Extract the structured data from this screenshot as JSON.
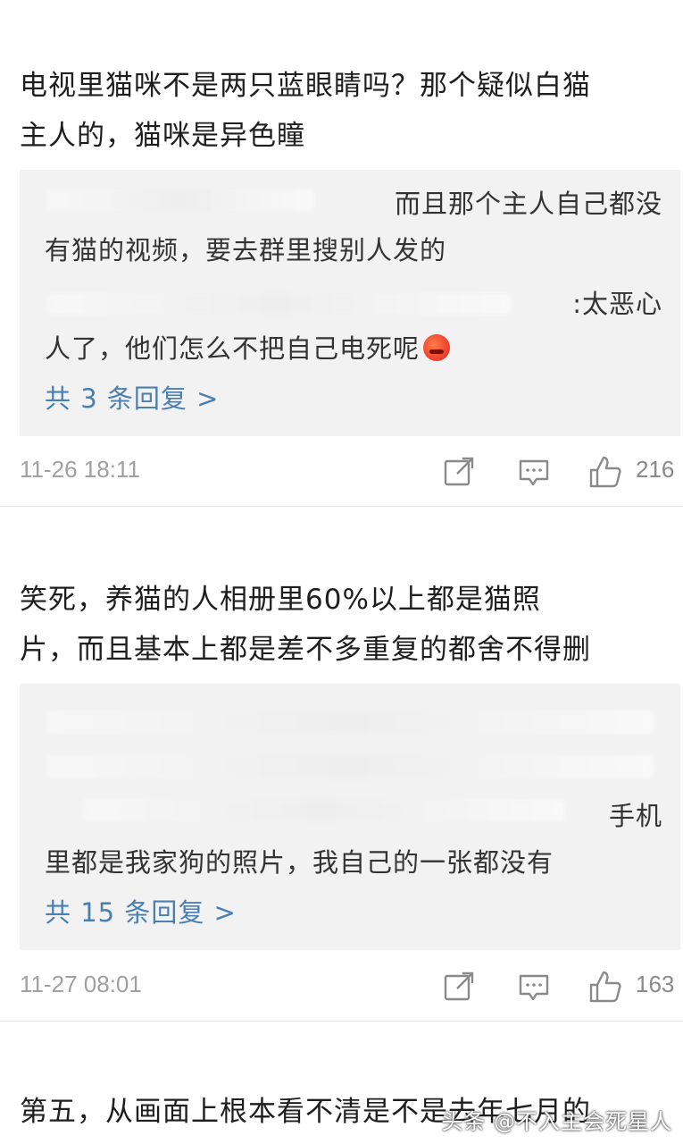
{
  "comments": [
    {
      "text_lines": [
        "电视里猫咪不是两只蓝眼睛吗？那个疑似白猫",
        "主人的，猫咪是异色瞳"
      ],
      "replies": {
        "line1": "而且那个主人自己都没",
        "line2": "有猫的视频，要去群里搜别人发的",
        "line3": ":太恶心",
        "line4": "人了，他们怎么不把自己电死呢",
        "more": "共 3 条回复 >"
      },
      "timestamp": "11-26 18:11",
      "likes": "216"
    },
    {
      "text_lines": [
        "笑死，养猫的人相册里60%以上都是猫照",
        "片，而且基本上都是差不多重复的都舍不得删"
      ],
      "replies": {
        "line1": "手机",
        "line2": "里都是我家狗的照片，我自己的一张都没有",
        "more": "共 15 条回复 >"
      },
      "timestamp": "11-27 08:01",
      "likes": "163"
    },
    {
      "text_lines": [
        "第五，从画面上根本看不清是不是去年七月的"
      ]
    }
  ],
  "icons": {
    "share": "share-icon",
    "comment": "comment-icon",
    "like": "like-icon",
    "emoji": "angry-face-emoji"
  },
  "watermark": "头条 @不入主会死星人",
  "colors": {
    "link": "#4a7fb0",
    "reply_bg": "#f2f2f2",
    "meta": "#a0a0a0"
  }
}
